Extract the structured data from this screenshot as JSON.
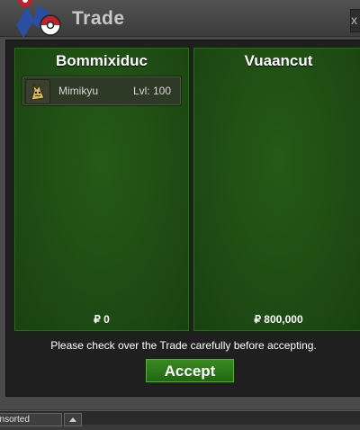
{
  "window": {
    "title": "Trade",
    "close_label": "x"
  },
  "panels": {
    "left": {
      "player": "Bommixiduc",
      "items": [
        {
          "name": "Mimikyu",
          "level": "Lvl: 100",
          "icon": "mimikyu-icon"
        }
      ],
      "money": "₽ 0"
    },
    "right": {
      "player": "Vuaancut",
      "items": [],
      "money": "₽ 800,000"
    }
  },
  "notice": "Please check over the Trade carefully before accepting.",
  "accept_label": "Accept",
  "bottom_bar": {
    "tab_label": "unsorted"
  },
  "colors": {
    "panel_green": "#1f4d14",
    "accept_green": "#2a7a18",
    "logo_blue": "#2a4ea0",
    "logo_red": "#c0202a"
  }
}
